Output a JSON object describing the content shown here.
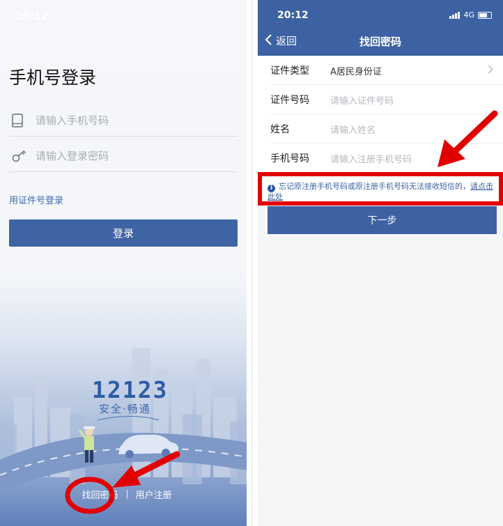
{
  "left": {
    "status_time": "20:12",
    "page_title": "手机号登录",
    "phone_placeholder": "请输入手机号码",
    "password_placeholder": "请输入登录密码",
    "id_login_link": "用证件号登录",
    "login_button": "登录",
    "brand_number": "12123",
    "brand_slogan": "安全·畅通",
    "forgot_password_link": "找回密码",
    "register_link": "用户注册"
  },
  "right": {
    "status_time": "20:12",
    "network": "4G",
    "back_label": "返回",
    "title": "找回密码",
    "form": {
      "id_type_label": "证件类型",
      "id_type_value": "A居民身份证",
      "id_number_label": "证件号码",
      "id_number_placeholder": "请输入证件号码",
      "name_label": "姓名",
      "name_placeholder": "请输入姓名",
      "phone_label": "手机号码",
      "phone_placeholder": "请输入注册手机号码"
    },
    "notice_text": "忘记原注册手机号码或原注册手机号码无法接收短信的，",
    "notice_link": "请点击此处",
    "next_button": "下一步"
  },
  "colors": {
    "primary": "#3d62a3",
    "annotation_red": "#e10000",
    "link_blue": "#3e69ad"
  }
}
